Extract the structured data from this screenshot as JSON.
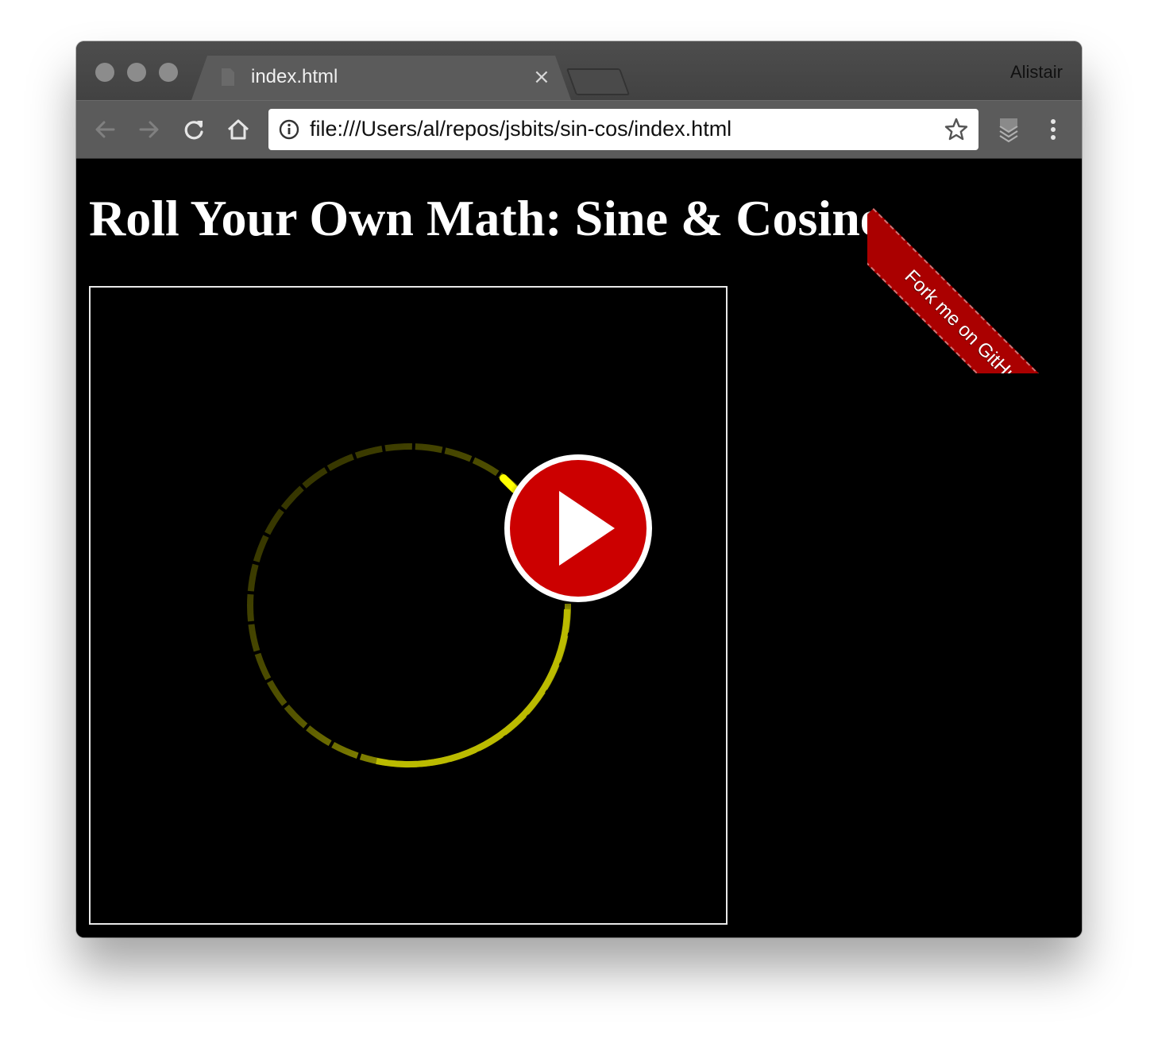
{
  "browser": {
    "tab_title": "index.html",
    "tab_close": "×",
    "profile_name": "Alistair",
    "url": "file:///Users/al/repos/jsbits/sin-cos/index.html",
    "toolbar_icons": [
      "back-arrow-icon",
      "forward-arrow-icon",
      "reload-icon",
      "home-icon",
      "info-icon",
      "bookmark-star-icon",
      "extension-icon",
      "menu-dots-icon"
    ]
  },
  "page": {
    "heading": "Roll Your Own Math: Sine & Cosine",
    "ribbon_label": "Fork me on GitHub",
    "animation": {
      "stroke_color": "#cccc00",
      "highlight_color": "#ffff00",
      "play_button_color": "#cc0000"
    }
  }
}
